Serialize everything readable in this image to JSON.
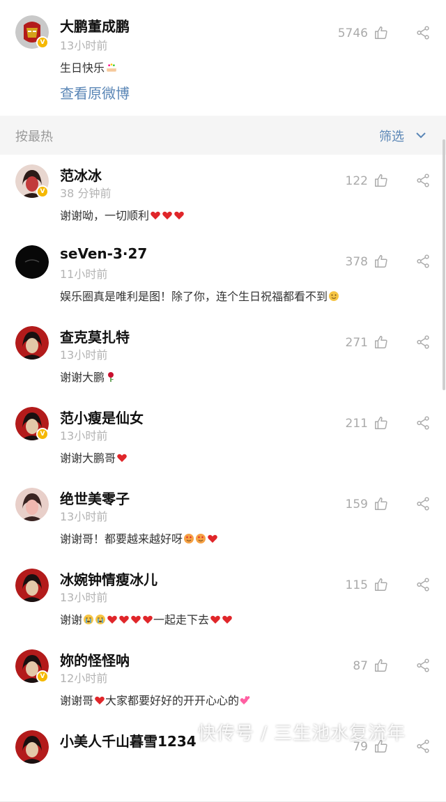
{
  "post": {
    "author": "大鹏董成鹏",
    "time": "13小时前",
    "content": "生日快乐",
    "likes": "5746",
    "view_original": "查看原微博"
  },
  "sortbar": {
    "sort_label": "按最热",
    "filter_label": "筛选"
  },
  "comments": [
    {
      "name": "范冰冰",
      "time": "38 分钟前",
      "text": "谢谢呦，一切顺利",
      "likes": "122",
      "emojis": [
        "heart",
        "heart",
        "heart"
      ]
    },
    {
      "name": "seVen-3·27",
      "time": "11小时前",
      "text": "娱乐圈真是唯利是图！除了你，连个生日祝福都看不到",
      "likes": "378",
      "emojis": [
        "smile"
      ]
    },
    {
      "name": "查克莫扎特",
      "time": "13小时前",
      "text": "谢谢大鹏",
      "likes": "271",
      "emojis": [
        "rose"
      ]
    },
    {
      "name": "范小瘦是仙女",
      "time": "13小时前",
      "text": "谢谢大鹏哥",
      "likes": "211",
      "emojis": [
        "heart"
      ]
    },
    {
      "name": "绝世美零子",
      "time": "13小时前",
      "text": "谢谢哥！都要越来越好呀",
      "likes": "159",
      "emojis": [
        "lovesmile",
        "lovesmile",
        "heart"
      ]
    },
    {
      "name": "冰婉钟情瘦冰儿",
      "time": "13小时前",
      "text_a": "谢谢",
      "text_b": "一起走下去",
      "likes": "115"
    },
    {
      "name": "妳的怪怪呐",
      "time": "12小时前",
      "text": "谢谢哥",
      "text_c": "大家都要好好的开开心心的",
      "likes": "87"
    },
    {
      "name": "小美人千山暮雪1234",
      "time": "",
      "text": "",
      "likes": "79"
    }
  ],
  "watermark": "快传号 / 三生池水复流年",
  "colors": {
    "link": "#5a86b6",
    "muted": "#b3b3b3",
    "heart": "#e0262a",
    "badge": "#f5b800"
  }
}
